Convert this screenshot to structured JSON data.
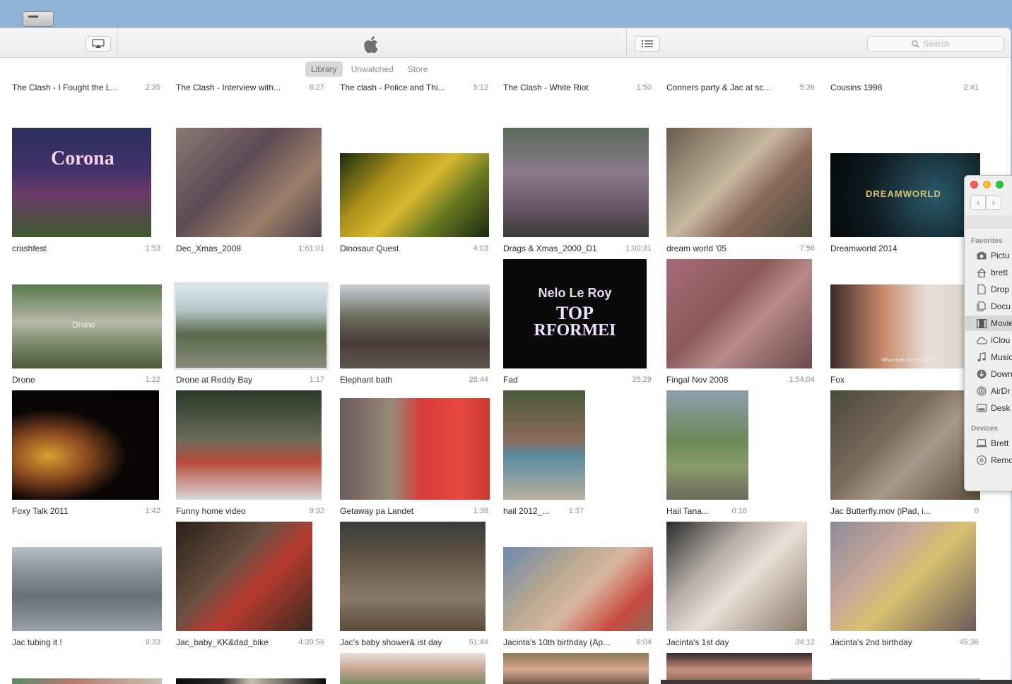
{
  "toolbar": {
    "search_placeholder": "Search"
  },
  "tabs": [
    {
      "label": "Library",
      "active": true
    },
    {
      "label": "Unwatched",
      "active": false
    },
    {
      "label": "Store",
      "active": false
    }
  ],
  "rows": [
    [
      {
        "title": "The Clash - I Fought the L...",
        "duration": "2:35"
      },
      {
        "title": "The Clash - Interview with...",
        "duration": "8:27"
      },
      {
        "title": "The clash - Police and Thi...",
        "duration": "5:12"
      },
      {
        "title": "The Clash - White Riot",
        "duration": "1:50"
      },
      {
        "title": "Conners party & Jac at sc...",
        "duration": "5:36"
      },
      {
        "title": "Cousins 1998",
        "duration": "2:41"
      }
    ],
    [
      {
        "title": "crashfest",
        "duration": "1:53"
      },
      {
        "title": "Dec_Xmas_2008",
        "duration": "1:61:01"
      },
      {
        "title": "Dinosaur Quest",
        "duration": "4:03"
      },
      {
        "title": "Drags & Xmas_2000_D1",
        "duration": "1:00:31"
      },
      {
        "title": "dream world '05",
        "duration": "7:56"
      },
      {
        "title": "Dreamworld 2014",
        "duration": ""
      }
    ],
    [
      {
        "title": "Drone",
        "duration": "1:22"
      },
      {
        "title": "Drone at Reddy Bay",
        "duration": "1:17"
      },
      {
        "title": "Elephant bath",
        "duration": "28:44"
      },
      {
        "title": "Fad",
        "duration": "25:29"
      },
      {
        "title": "Fingal Nov 2008",
        "duration": "1:54:04"
      },
      {
        "title": "Fox",
        "duration": ""
      }
    ],
    [
      {
        "title": "Foxy Talk 2011",
        "duration": "1:42"
      },
      {
        "title": "Funny home video",
        "duration": "9:32"
      },
      {
        "title": "Getaway pa Landet",
        "duration": "1:38"
      },
      {
        "title": "hail 2012_...",
        "duration": "1:37"
      },
      {
        "title": "Hail Tana...",
        "duration": "0:16"
      },
      {
        "title": "Jac Butterfly.mov (iPad, i...",
        "duration": "0"
      }
    ],
    [
      {
        "title": "Jac tubing it !",
        "duration": "9:33"
      },
      {
        "title": "Jac_baby_KK&dad_bike",
        "duration": "4:39:56"
      },
      {
        "title": "Jac's baby shower& ist day",
        "duration": "51:44"
      },
      {
        "title": "Jacinta's 10th birthday (Ap...",
        "duration": "6:04"
      },
      {
        "title": "Jacinta's 1st day",
        "duration": "34:12"
      },
      {
        "title": "Jacinta's 2nd birthday",
        "duration": "45:36"
      }
    ]
  ],
  "thumb_text": {
    "crashfest": "Corona",
    "drone": "Drone",
    "dreamworld": "DREAMWORLD",
    "fad_1": "Nelo Le Roy",
    "fad_2": "TOP",
    "fad_3": "RFORMEI",
    "fox": "What does the fox say?"
  },
  "finder": {
    "favorites_header": "Favorites",
    "favorites": [
      {
        "label": "Pictu",
        "icon": "camera-icon"
      },
      {
        "label": "brett",
        "icon": "home-icon"
      },
      {
        "label": "Drop",
        "icon": "document-icon"
      },
      {
        "label": "Docu",
        "icon": "documents-icon"
      },
      {
        "label": "Movie",
        "icon": "film-icon",
        "selected": true
      },
      {
        "label": "iClou",
        "icon": "cloud-icon"
      },
      {
        "label": "Music",
        "icon": "music-note-icon"
      },
      {
        "label": "Down",
        "icon": "download-icon"
      },
      {
        "label": "AirDr",
        "icon": "airdrop-icon"
      },
      {
        "label": "Desk",
        "icon": "desktop-icon"
      }
    ],
    "devices_header": "Devices",
    "devices": [
      {
        "label": "Brett",
        "icon": "laptop-icon"
      },
      {
        "label": "Remo",
        "icon": "disc-icon"
      }
    ]
  }
}
